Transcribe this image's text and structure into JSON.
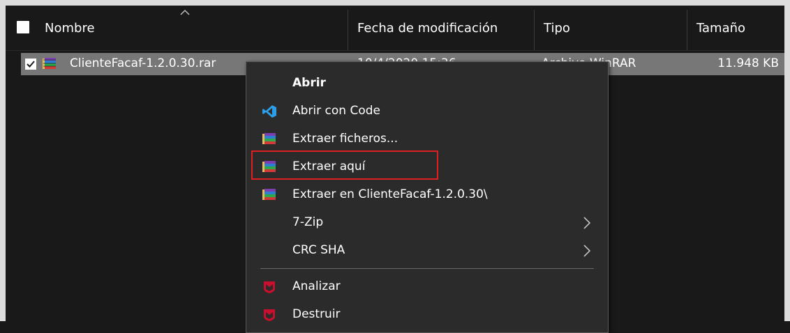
{
  "columns": {
    "name": "Nombre",
    "modified": "Fecha de modificación",
    "type": "Tipo",
    "size": "Tamaño"
  },
  "file": {
    "name": "ClienteFacaf-1.2.0.30.rar",
    "modified": "10/4/2020 15:36",
    "type": "Archivo WinRAR",
    "size": "11.948 KB",
    "checked": true
  },
  "context_menu": {
    "items": [
      {
        "label": "Abrir",
        "icon": "none",
        "bold": true
      },
      {
        "label": "Abrir con Code",
        "icon": "vscode-icon"
      },
      {
        "label": "Extraer ficheros...",
        "icon": "winrar-icon"
      },
      {
        "label": "Extraer aquí",
        "icon": "winrar-icon",
        "highlighted": true
      },
      {
        "label": "Extraer en ClienteFacaf-1.2.0.30\\",
        "icon": "winrar-icon"
      },
      {
        "label": "7-Zip",
        "icon": "none",
        "submenu": true
      },
      {
        "label": "CRC SHA",
        "icon": "none",
        "submenu": true
      },
      {
        "label": "Analizar",
        "icon": "mcafee-icon"
      },
      {
        "label": "Destruir",
        "icon": "mcafee-icon"
      }
    ]
  },
  "colors": {
    "background": "#191919",
    "selected_row": "#777777",
    "menu_background": "#2b2b2b",
    "highlight": "#e02020",
    "vscode_blue": "#2d9ee8",
    "mcafee_red": "#c8102e"
  }
}
